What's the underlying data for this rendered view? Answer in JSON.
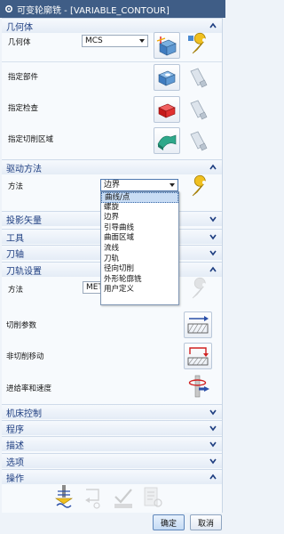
{
  "window": {
    "title": "可变轮廓铣 - [VARIABLE_CONTOUR]"
  },
  "geometry": {
    "title": "几何体",
    "geometry_label": "几何体",
    "geometry_value": "MCS",
    "specify_part": "指定部件",
    "specify_check": "指定检查",
    "specify_cut_area": "指定切削区域"
  },
  "drive": {
    "title": "驱动方法",
    "method_label": "方法",
    "method_value": "边界",
    "options": [
      "曲线/点",
      "螺旋",
      "边界",
      "引导曲线",
      "曲面区域",
      "流线",
      "刀轨",
      "径向切削",
      "外形轮廓铣",
      "用户定义"
    ],
    "selected_option": "曲线/点"
  },
  "sections": {
    "projection": "投影矢量",
    "tool": "工具",
    "tool_axis": "刀轴",
    "toolpath_settings": "刀轨设置",
    "machine_control": "机床控制",
    "program": "程序",
    "description": "描述",
    "options": "选项",
    "actions": "操作"
  },
  "toolpath": {
    "method_label": "方法",
    "method_value": "MET",
    "cut_params": "切削参数",
    "non_cut_moves": "非切削移动",
    "feeds_speeds": "进给率和速度"
  },
  "footer": {
    "ok": "确定",
    "cancel": "取消"
  },
  "icons": [
    "gear-icon",
    "chevron-up-icon",
    "chevron-down-icon",
    "mcs-icon",
    "wrench-icon",
    "part-icon",
    "flashlight-icon",
    "check-icon",
    "cut-area-icon",
    "drive-method-icon",
    "cut-params-icon",
    "non-cut-moves-icon",
    "feeds-speeds-icon",
    "generate-icon",
    "replay-icon",
    "verify-icon",
    "list-icon"
  ]
}
